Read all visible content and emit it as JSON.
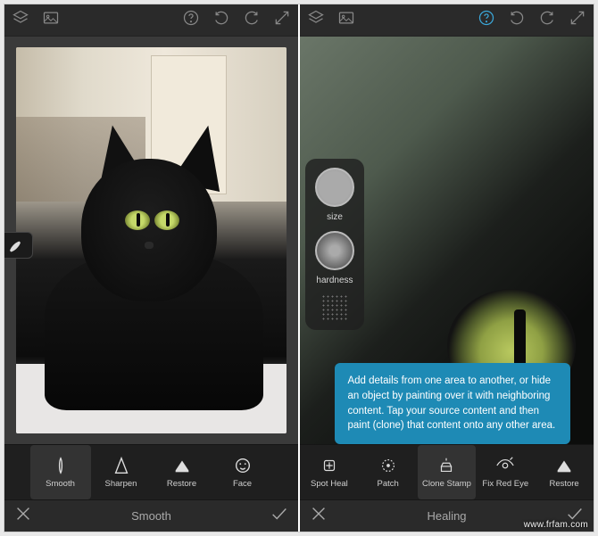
{
  "watermark": "www.frfam.com",
  "left": {
    "title": "Smooth",
    "tools": [
      {
        "key": "smooth",
        "label": "Smooth"
      },
      {
        "key": "sharpen",
        "label": "Sharpen"
      },
      {
        "key": "restore",
        "label": "Restore"
      },
      {
        "key": "face",
        "label": "Face"
      }
    ],
    "active_tool": "smooth"
  },
  "right": {
    "title": "Healing",
    "tools": [
      {
        "key": "spot",
        "label": "Spot Heal"
      },
      {
        "key": "patch",
        "label": "Patch"
      },
      {
        "key": "clone",
        "label": "Clone Stamp"
      },
      {
        "key": "redeye",
        "label": "Fix Red Eye"
      },
      {
        "key": "restore",
        "label": "Restore"
      }
    ],
    "active_tool": "clone",
    "controls": {
      "size_label": "size",
      "hardness_label": "hardness"
    },
    "tooltip": "Add details from one area to another, or hide an object by painting over it with neighboring content. Tap your source content and then paint (clone) that content onto any other area."
  },
  "icons": {
    "layers": "layers",
    "image": "image",
    "help": "help",
    "undo": "undo",
    "redo": "redo",
    "fullscreen": "fullscreen",
    "cancel": "cancel",
    "accept": "accept",
    "brush": "brush",
    "grid": "grid"
  }
}
